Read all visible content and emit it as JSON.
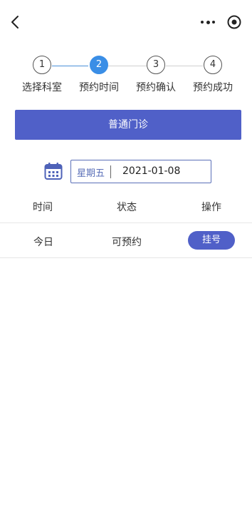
{
  "nav": {
    "back_icon": "chevron-left-icon",
    "more_icon": "more-dots-icon",
    "target_icon": "target-circle-icon"
  },
  "steps": [
    {
      "number": "1",
      "label": "选择科室",
      "active": false
    },
    {
      "number": "2",
      "label": "预约时间",
      "active": true
    },
    {
      "number": "3",
      "label": "预约确认",
      "active": false
    },
    {
      "number": "4",
      "label": "预约成功",
      "active": false
    }
  ],
  "banner": {
    "title": "普通门诊"
  },
  "date_picker": {
    "icon": "calendar-icon",
    "weekday": "星期五",
    "date": "2021-01-08"
  },
  "table": {
    "headers": [
      "时间",
      "状态",
      "操作"
    ],
    "rows": [
      {
        "time": "今日",
        "status": "可预约",
        "action": "挂号"
      }
    ]
  },
  "colors": {
    "primary": "#5060c8",
    "step_active": "#3a8ee6",
    "accent_border": "#5a6fb8"
  }
}
